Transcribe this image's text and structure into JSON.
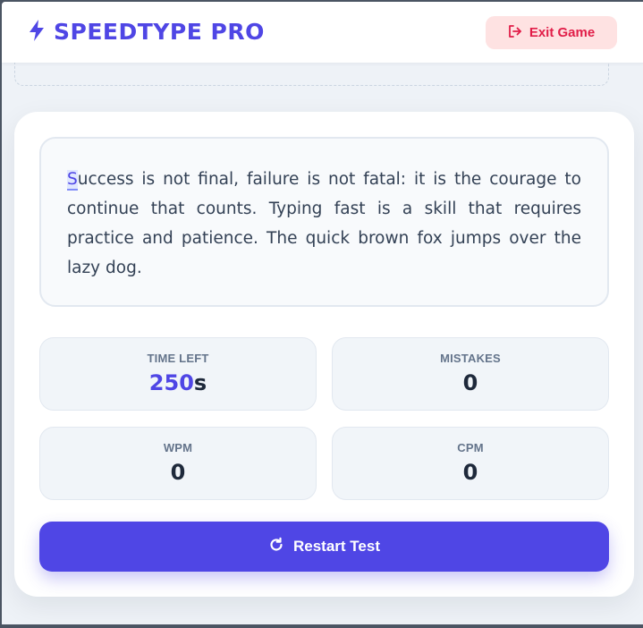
{
  "app": {
    "title": "SPEEDTYPE PRO",
    "brand_icon": "bolt-icon",
    "accent_color": "#4f46e5"
  },
  "header": {
    "exit_label": "Exit Game",
    "exit_icon": "sign-out-icon",
    "exit_color": "#e11d48"
  },
  "passage": {
    "current_char": "S",
    "remaining_text": "uccess is not final, failure is not fatal: it is the courage to continue that counts. Typing fast is a skill that requires practice and patience. The quick brown fox jumps over the lazy dog."
  },
  "stats": {
    "time_left": {
      "label": "TIME LEFT",
      "value": "250",
      "unit": "s"
    },
    "mistakes": {
      "label": "MISTAKES",
      "value": "0"
    },
    "wpm": {
      "label": "WPM",
      "value": "0"
    },
    "cpm": {
      "label": "CPM",
      "value": "0"
    }
  },
  "actions": {
    "restart_label": "Restart Test",
    "restart_icon": "redo-icon"
  }
}
